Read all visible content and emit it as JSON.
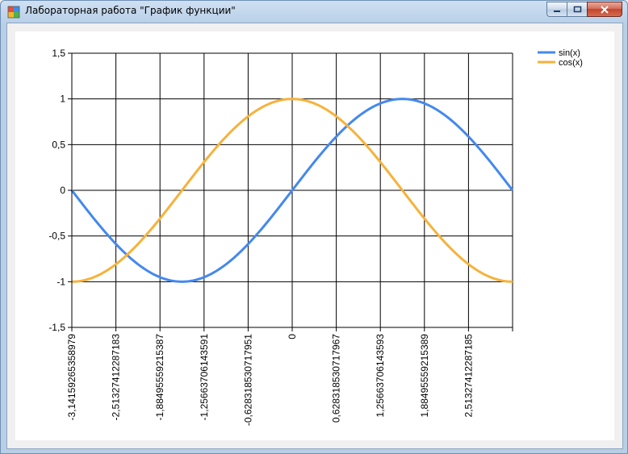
{
  "window": {
    "title": "Лабораторная работа \"График функции\"",
    "icons": {
      "app": "app-window-icon",
      "minimize": "minimize-icon",
      "maximize": "maximize-icon",
      "close": "close-icon"
    }
  },
  "chart_data": {
    "type": "line",
    "title": "",
    "xlabel": "",
    "ylabel": "",
    "xlim": [
      -3.14159265358979,
      3.14159265358979
    ],
    "ylim": [
      -1.5,
      1.5
    ],
    "grid": true,
    "legend_position": "top-right",
    "x_tick_labels": [
      {
        "value": -3.14159265358979,
        "label": "-3,14159265358979"
      },
      {
        "value": -2.51327412287183,
        "label": "-2,51327412287183"
      },
      {
        "value": -1.88495559215387,
        "label": "-1,88495559215387"
      },
      {
        "value": -1.25663706143591,
        "label": "-1,25663706143591"
      },
      {
        "value": -0.628318530717951,
        "label": "-0,628318530717951"
      },
      {
        "value": 0,
        "label": "0"
      },
      {
        "value": 0.628318530717967,
        "label": "0,628318530717967"
      },
      {
        "value": 1.25663706143593,
        "label": "1,25663706143593"
      },
      {
        "value": 1.88495559215389,
        "label": "1,88495559215389"
      },
      {
        "value": 2.51327412287185,
        "label": "2,51327412287185"
      }
    ],
    "y_tick_labels": [
      {
        "value": 1.5,
        "label": "1,5"
      },
      {
        "value": 1,
        "label": "1"
      },
      {
        "value": 0.5,
        "label": "0,5"
      },
      {
        "value": 0,
        "label": "0"
      },
      {
        "value": -0.5,
        "label": "-0,5"
      },
      {
        "value": -1,
        "label": "-1"
      },
      {
        "value": -1.5,
        "label": "-1,5"
      }
    ],
    "x": [
      -3.14159,
      -2.82743,
      -2.51327,
      -2.19911,
      -1.88496,
      -1.5708,
      -1.25664,
      -0.94248,
      -0.62832,
      -0.31416,
      0,
      0.31416,
      0.62832,
      0.94248,
      1.25664,
      1.5708,
      1.88496,
      2.19911,
      2.51327,
      2.82743,
      3.14159
    ],
    "series": [
      {
        "name": "sin(x)",
        "color": "#4488ee",
        "values": [
          0,
          -0.309,
          -0.588,
          -0.809,
          -0.951,
          -1,
          -0.951,
          -0.809,
          -0.588,
          -0.309,
          0,
          0.309,
          0.588,
          0.809,
          0.951,
          1,
          0.951,
          0.809,
          0.588,
          0.309,
          0
        ]
      },
      {
        "name": "cos(x)",
        "color": "#f6b23b",
        "values": [
          -1,
          -0.951,
          -0.809,
          -0.588,
          -0.309,
          0,
          0.309,
          0.588,
          0.809,
          0.951,
          1,
          0.951,
          0.809,
          0.588,
          0.309,
          0,
          -0.309,
          -0.588,
          -0.809,
          -0.951,
          -1
        ]
      }
    ]
  }
}
